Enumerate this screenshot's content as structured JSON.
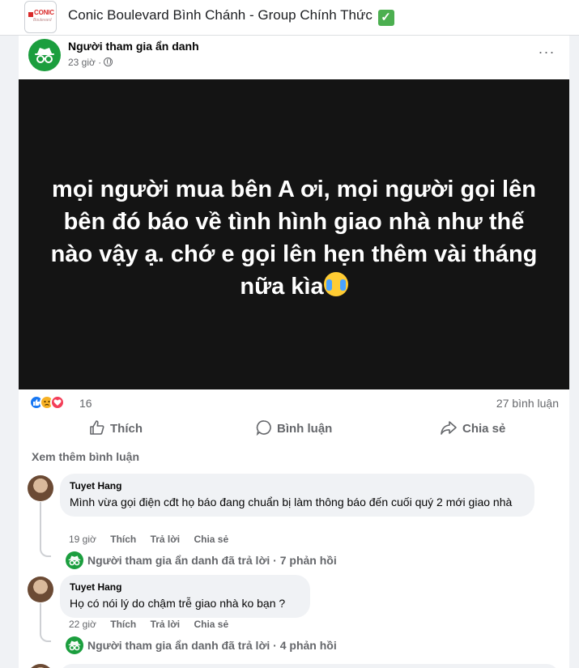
{
  "group": {
    "title": "Conic Boulevard Bình Chánh - Group Chính Thức",
    "verified_emoji": "✓",
    "logo_text": "CONIC",
    "logo_subtext": "Boulevard"
  },
  "post": {
    "author": "Người tham gia ẩn danh",
    "time": "23 giờ ·",
    "privacy_icon": "globe-icon",
    "more_icon": "···",
    "text": "mọi người mua bên A ơi, mọi người gọi lên bên đó báo về tình hình giao nhà như thế nào vậy ạ. chớ e gọi lên hẹn thêm vài tháng nữa kìa",
    "emoji": "crying-face",
    "image_background": "#141414",
    "reaction_count": "16",
    "comment_count": "27 bình luận"
  },
  "actions": {
    "like": "Thích",
    "comment": "Bình luận",
    "share": "Chia sẻ"
  },
  "view_more_comments": "Xem thêm bình luận",
  "comments": [
    {
      "name": "Tuyet Hang",
      "text": "Mình vừa gọi điện cđt họ báo đang chuẩn bị làm thông báo đến cuối quý 2 mới giao nhà",
      "time": "19 giờ",
      "like": "Thích",
      "reply": "Trả lời",
      "share": "Chia sẻ",
      "replies_summary": "Người tham gia ẩn danh đã trả lời · 7 phản hồi"
    },
    {
      "name": "Tuyet Hang",
      "text": "Họ có nói lý do chậm trễ giao nhà ko bạn ?",
      "time": "22 giờ",
      "like": "Thích",
      "reply": "Trả lời",
      "share": "Chia sẻ",
      "replies_summary": "Người tham gia ẩn danh đã trả lời · 4 phản hồi"
    }
  ],
  "colors": {
    "brand_green": "#1b9e3e",
    "facebook_blue": "#1877f2",
    "muted_text": "#65676b"
  }
}
